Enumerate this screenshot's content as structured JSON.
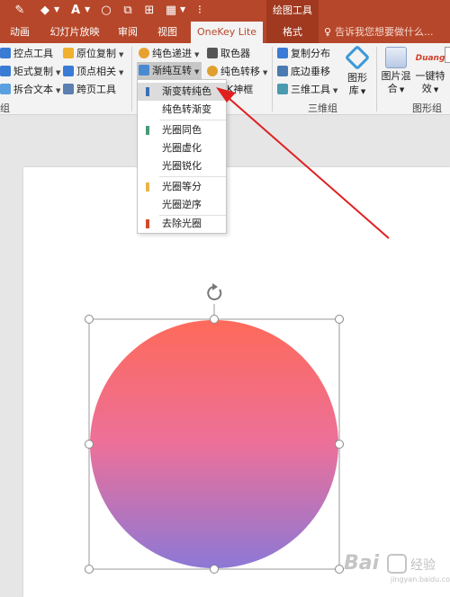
{
  "titlebar": {
    "context_title": "绘图工具"
  },
  "tabs": [
    {
      "label": "动画"
    },
    {
      "label": "幻灯片放映"
    },
    {
      "label": "审阅"
    },
    {
      "label": "视图"
    },
    {
      "label": "OneKey Lite"
    },
    {
      "label": "格式"
    }
  ],
  "tellme": "告诉我您想要做什么...",
  "ribbon": {
    "col1": [
      "控点工具",
      "矩式复制",
      "拆合文本"
    ],
    "col2": [
      "原位复制",
      "顶点相关",
      "跨页工具"
    ],
    "col3": [
      "纯色递进",
      "渐纯互转"
    ],
    "col4": [
      "取色器",
      "纯色转移",
      "K神框"
    ],
    "col5": [
      "复制分布",
      "底边垂移",
      "三维工具"
    ],
    "big": [
      {
        "label": "图形",
        "label2": "库"
      },
      {
        "label": "图片混",
        "label2": "合"
      },
      {
        "label": "一键特",
        "label2": "效"
      }
    ],
    "duang": "Duang",
    "group_labels": [
      "组",
      "三维组",
      "图形组"
    ]
  },
  "dropdown": {
    "items": [
      {
        "label": "渐变转纯色",
        "color": "#3b6fb6"
      },
      {
        "label": "纯色转渐变",
        "color": ""
      },
      {
        "label": "光圈同色",
        "color": "#4a9a7a"
      },
      {
        "label": "光圈虚化",
        "color": ""
      },
      {
        "label": "光圈锐化",
        "color": ""
      },
      {
        "label": "光圈等分",
        "color": "#e8b54a"
      },
      {
        "label": "光圈逆序",
        "color": ""
      },
      {
        "label": "去除光圈",
        "color": "#d04a2a"
      }
    ]
  },
  "colors": {
    "accent": "#b7472a",
    "arrow": "#e02020",
    "gradient_top": "#fe6a5a",
    "gradient_mid": "#ec709a",
    "gradient_bottom": "#8c78d6"
  },
  "watermark": {
    "text": "Bai",
    "text2": "经验",
    "sub": "jingyan.baidu.com"
  }
}
